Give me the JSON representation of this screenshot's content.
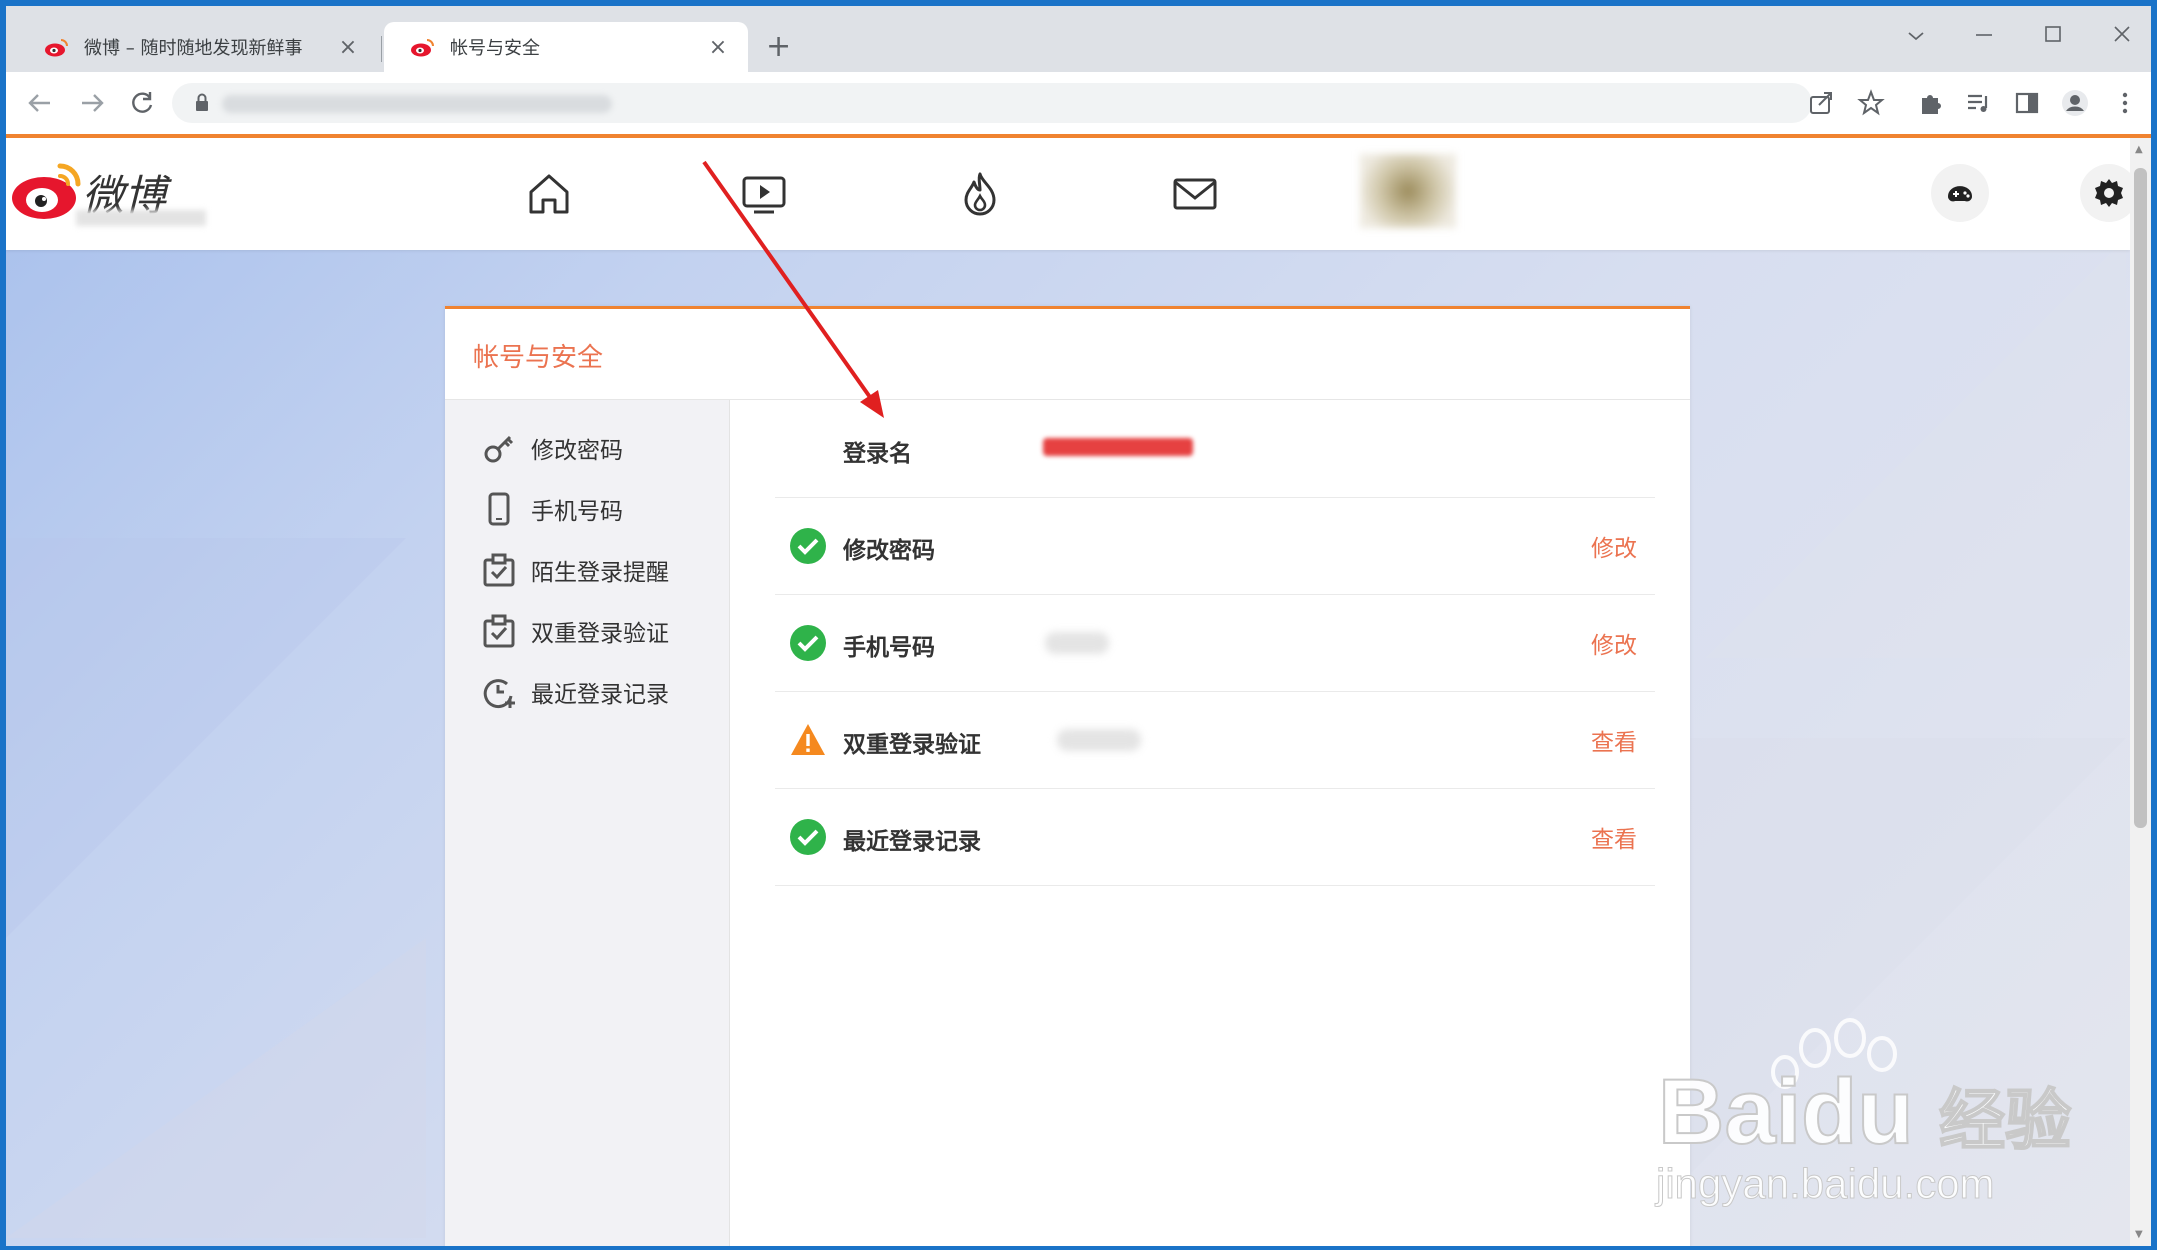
{
  "browser": {
    "tabs": [
      {
        "title": "微博 – 随时随地发现新鲜事",
        "active": false
      },
      {
        "title": "帐号与安全",
        "active": true
      }
    ],
    "new_tab": "+",
    "close": "×"
  },
  "weibo": {
    "logo_text": "微博",
    "nav_icons": [
      "home-icon",
      "video-icon",
      "hot-icon",
      "mail-icon"
    ]
  },
  "card": {
    "title": "帐号与安全",
    "sidebar": [
      {
        "label": "修改密码",
        "icon": "key-icon"
      },
      {
        "label": "手机号码",
        "icon": "phone-icon"
      },
      {
        "label": "陌生登录提醒",
        "icon": "check-calendar-icon"
      },
      {
        "label": "双重登录验证",
        "icon": "check-calendar-icon"
      },
      {
        "label": "最近登录记录",
        "icon": "clock-plus-icon"
      }
    ],
    "rows": [
      {
        "label": "登录名",
        "status": "none",
        "action": ""
      },
      {
        "label": "修改密码",
        "status": "ok",
        "action": "修改"
      },
      {
        "label": "手机号码",
        "status": "ok",
        "action": "修改"
      },
      {
        "label": "双重登录验证",
        "status": "warning",
        "action": "查看"
      },
      {
        "label": "最近登录记录",
        "status": "ok",
        "action": "查看"
      }
    ]
  },
  "watermark": {
    "brand": "Bai",
    "brand_tail": "du",
    "cn": "经验",
    "url": "jingyan.baidu.com"
  },
  "colors": {
    "accent": "#eb7350",
    "ok": "#2fb34a",
    "warning": "#f5891f",
    "weibo_red": "#e6162d"
  }
}
